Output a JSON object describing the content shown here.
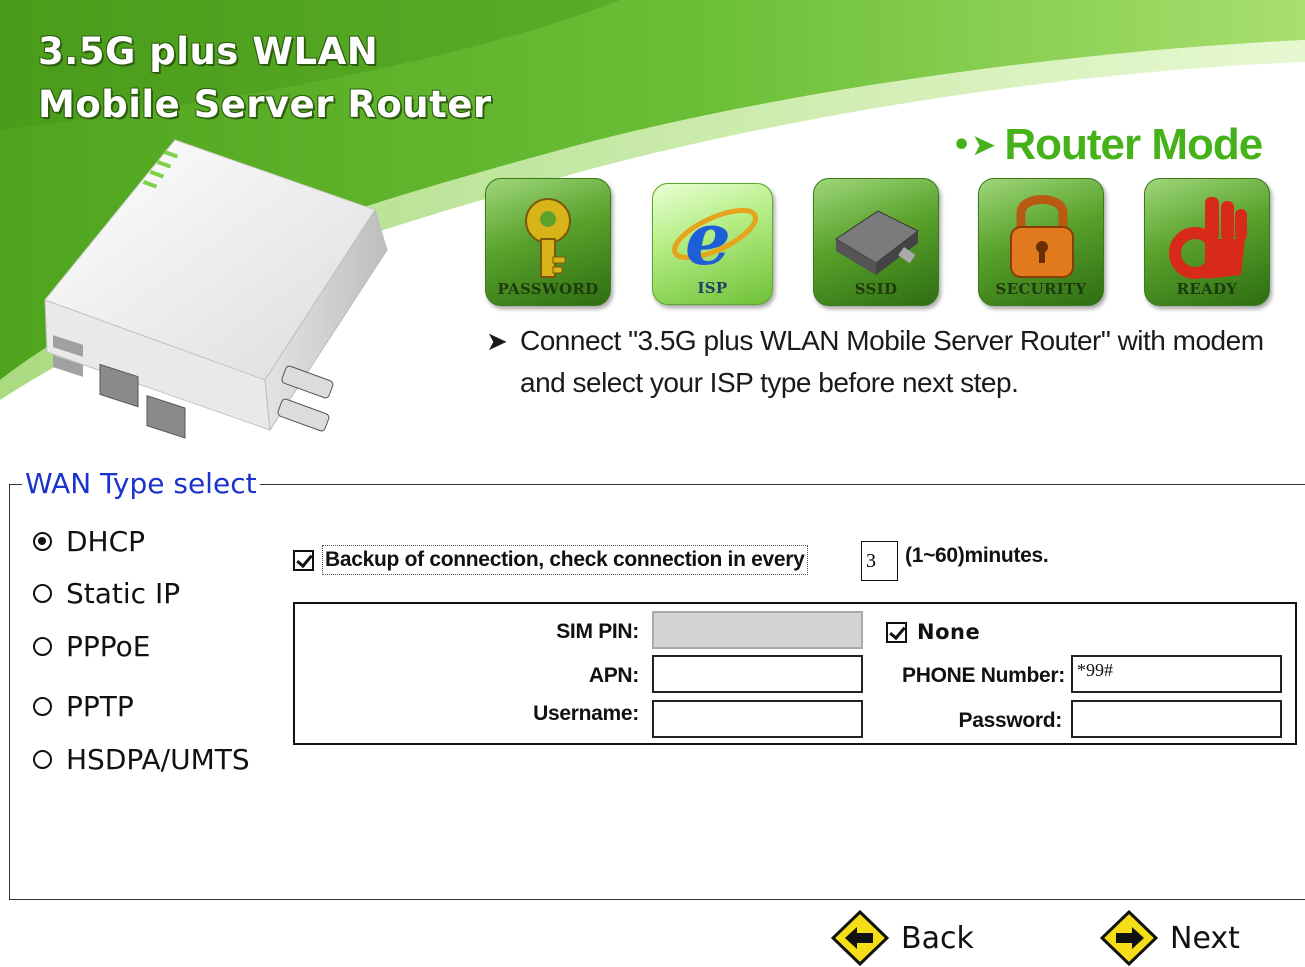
{
  "header": {
    "title_line1": "3.5G plus WLAN",
    "title_line2": "Mobile Server Router",
    "mode_title": "Router Mode",
    "colors": {
      "brand_green": "#46b21a",
      "swoosh_green": "#5bb327"
    }
  },
  "steps": [
    {
      "label": "PASSWORD",
      "icon": "key-icon",
      "active": false
    },
    {
      "label": "ISP",
      "icon": "internet-explorer-icon",
      "active": true
    },
    {
      "label": "SSID",
      "icon": "router-device-icon",
      "active": false
    },
    {
      "label": "SECURITY",
      "icon": "padlock-icon",
      "active": false
    },
    {
      "label": "READY",
      "icon": "ok-hand-icon",
      "active": false
    }
  ],
  "instruction": {
    "text": "Connect \"3.5G plus WLAN Mobile Server Router\" with modem and select  your ISP type before next step."
  },
  "wan": {
    "legend": "WAN Type select",
    "options": [
      {
        "label": "DHCP",
        "selected": true
      },
      {
        "label": "Static IP",
        "selected": false
      },
      {
        "label": "PPPoE",
        "selected": false
      },
      {
        "label": "PPTP",
        "selected": false
      },
      {
        "label": "HSDPA/UMTS",
        "selected": false
      }
    ],
    "backup": {
      "checked": true,
      "label": "Backup of connection, check connection in every",
      "minutes_value": "3",
      "range_text": "(1~60)minutes."
    },
    "hsdpa": {
      "sim_pin_label": "SIM PIN:",
      "sim_pin_value": "",
      "none_checked": true,
      "none_label": "None",
      "apn_label": "APN:",
      "apn_value": "",
      "phone_label": "PHONE Number:",
      "phone_value": "*99#",
      "username_label": "Username:",
      "username_value": "",
      "password_label": "Password:",
      "password_value": ""
    }
  },
  "nav": {
    "back_label": "Back",
    "next_label": "Next",
    "icon_color": "#f5dd18"
  }
}
